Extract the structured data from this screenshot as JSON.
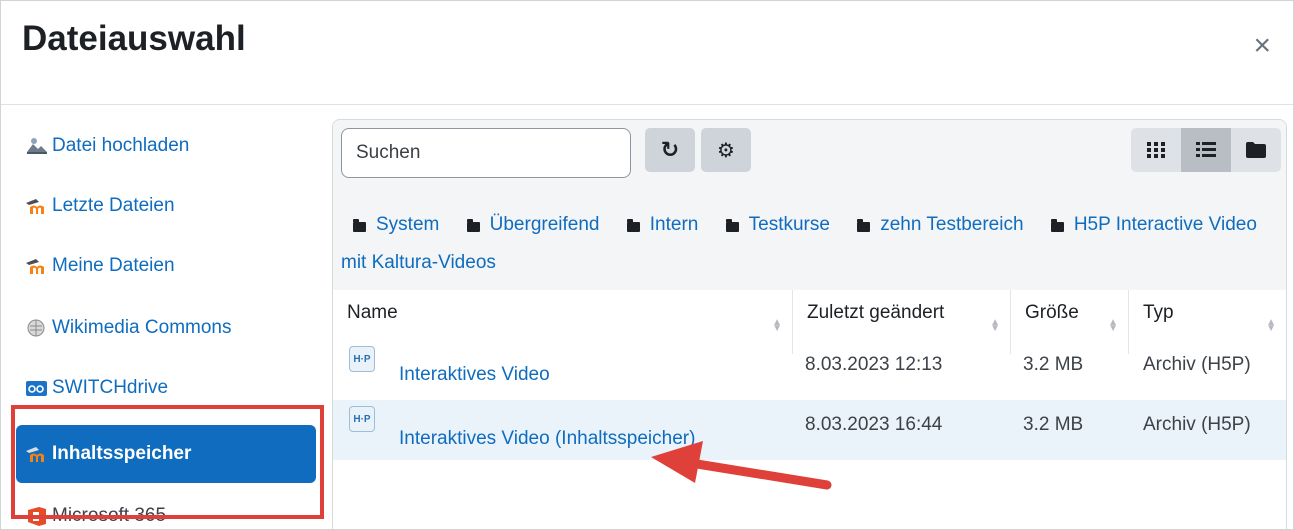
{
  "dialog": {
    "title": "Dateiauswahl",
    "close_symbol": "×"
  },
  "sidebar": {
    "items": [
      {
        "label": "Datei hochladen",
        "icon": "upload-icon"
      },
      {
        "label": "Letzte Dateien",
        "icon": "moodle-icon"
      },
      {
        "label": "Meine Dateien",
        "icon": "moodle-icon"
      },
      {
        "label": "Wikimedia Commons",
        "icon": "wikimedia-icon"
      },
      {
        "label": "SWITCHdrive",
        "icon": "switchdrive-icon"
      },
      {
        "label": "Inhaltsspeicher",
        "icon": "moodle-icon",
        "active": true
      },
      {
        "label": "Microsoft 365",
        "icon": "microsoft-365-icon"
      }
    ]
  },
  "toolbar": {
    "search_placeholder": "Suchen",
    "refresh_symbol": "↻",
    "settings_symbol": "⚙"
  },
  "breadcrumb": [
    "System",
    "Übergreifend",
    "Intern",
    "Testkurse",
    "zehn Testbereich",
    "H5P Interactive Video mit Kaltura-Videos"
  ],
  "table": {
    "columns": [
      "Name",
      "Zuletzt geändert",
      "Größe",
      "Typ"
    ],
    "rows": [
      {
        "name": "Interaktives Video",
        "modified": "8.03.2023 12:13",
        "size": "3.2 MB",
        "type": "Archiv (H5P)",
        "icon_text": "H·P"
      },
      {
        "name": "Interaktives Video (Inhaltsspeicher)",
        "modified": "8.03.2023 16:44",
        "size": "3.2 MB",
        "type": "Archiv (H5P)",
        "icon_text": "H·P"
      }
    ]
  },
  "colors": {
    "accent": "#0f6cbf",
    "annotation": "#e0403a",
    "selected_row": "#eaf2fa"
  }
}
